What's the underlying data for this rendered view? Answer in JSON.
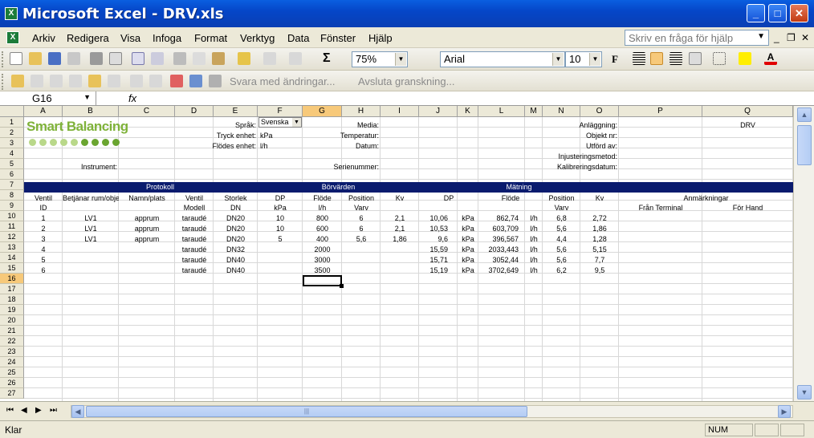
{
  "window": {
    "title": "Microsoft Excel - DRV.xls",
    "app_icon": "excel-icon"
  },
  "menu": [
    "Arkiv",
    "Redigera",
    "Visa",
    "Infoga",
    "Format",
    "Verktyg",
    "Data",
    "Fönster",
    "Hjälp"
  ],
  "help_box": {
    "placeholder": "Skriv en fråga för hjälp"
  },
  "toolbar": {
    "zoom": "75%",
    "font": "Arial",
    "size": "10",
    "bold": "F",
    "sigma": "Σ",
    "review_reply": "Svara med ändringar...",
    "review_end": "Avsluta granskning..."
  },
  "formula_bar": {
    "name_box": "G16",
    "fx": "fx",
    "value": ""
  },
  "columns": [
    "A",
    "B",
    "C",
    "D",
    "E",
    "F",
    "G",
    "H",
    "I",
    "J",
    "K",
    "L",
    "M",
    "N",
    "O",
    "P",
    "Q"
  ],
  "selected_column": "G",
  "rows": [
    "1",
    "2",
    "3",
    "4",
    "5",
    "6",
    "7",
    "8",
    "9",
    "10",
    "11",
    "12",
    "13",
    "14",
    "15",
    "16",
    "17",
    "18",
    "19",
    "20",
    "21",
    "22",
    "23",
    "24",
    "25",
    "26",
    "27"
  ],
  "selected_row": "16",
  "logo": {
    "text": "Smart Balancing"
  },
  "header": {
    "sprak_label": "Språk:",
    "sprak_value": "Svenska",
    "tryck_label": "Tryck enhet:",
    "tryck_value": "kPa",
    "flodes_label": "Flödes enhet:",
    "flodes_value": "l/h",
    "instrument_label": "Instrument:",
    "media_label": "Media:",
    "temperatur_label": "Temperatur:",
    "datum_label": "Datum:",
    "serienummer_label": "Serienummer:",
    "anlaggning_label": "Anläggning:",
    "anlaggning_value": "DRV",
    "objekt_label": "Objekt nr:",
    "utford_label": "Utförd av:",
    "injustering_label": "Injusteringsmetod:",
    "kalibrering_label": "Kalibreringsdatum:"
  },
  "band": {
    "protokoll": "Protokoll",
    "borvarden": "Börvärden",
    "matning": "Mätning"
  },
  "table_headers": {
    "ventil_id_1": "Ventil",
    "ventil_id_2": "ID",
    "betjanar": "Betjänar rum/objekt",
    "namn": "Namn/plats",
    "ventil_modell_1": "Ventil",
    "ventil_modell_2": "Modell",
    "storlek_1": "Storlek",
    "storlek_2": "DN",
    "dp_1": "DP",
    "dp_2": "kPa",
    "flode_1": "Flöde",
    "flode_2": "l/h",
    "position_1": "Position",
    "position_2": "Varv",
    "kv": "Kv",
    "m_dp": "DP",
    "m_flode": "Flöde",
    "m_position_1": "Position",
    "m_position_2": "Varv",
    "m_kv": "Kv",
    "anmarkningar": "Anmärkningar",
    "fran_terminal": "Från Terminal",
    "for_hand": "För Hand"
  },
  "data_rows": [
    {
      "id": "1",
      "betjanar": "LV1",
      "namn": "apprum",
      "modell": "taraudé",
      "dn": "DN20",
      "dp": "10",
      "flode": "800",
      "position": "6",
      "kv": "2,1",
      "m_dp": "10,06",
      "m_dp_unit": "kPa",
      "m_flode": "862,74",
      "m_flode_unit": "l/h",
      "m_position": "6,8",
      "m_kv": "2,72"
    },
    {
      "id": "2",
      "betjanar": "LV1",
      "namn": "apprum",
      "modell": "taraudé",
      "dn": "DN20",
      "dp": "10",
      "flode": "600",
      "position": "6",
      "kv": "2,1",
      "m_dp": "10,53",
      "m_dp_unit": "kPa",
      "m_flode": "603,709",
      "m_flode_unit": "l/h",
      "m_position": "5,6",
      "m_kv": "1,86"
    },
    {
      "id": "3",
      "betjanar": "LV1",
      "namn": "apprum",
      "modell": "taraudé",
      "dn": "DN20",
      "dp": "5",
      "flode": "400",
      "position": "5,6",
      "kv": "1,86",
      "m_dp": "9,6",
      "m_dp_unit": "kPa",
      "m_flode": "396,567",
      "m_flode_unit": "l/h",
      "m_position": "4,4",
      "m_kv": "1,28"
    },
    {
      "id": "4",
      "betjanar": "",
      "namn": "",
      "modell": "taraudé",
      "dn": "DN32",
      "dp": "",
      "flode": "2000",
      "position": "",
      "kv": "",
      "m_dp": "15,59",
      "m_dp_unit": "kPa",
      "m_flode": "2033,443",
      "m_flode_unit": "l/h",
      "m_position": "5,6",
      "m_kv": "5,15"
    },
    {
      "id": "5",
      "betjanar": "",
      "namn": "",
      "modell": "taraudé",
      "dn": "DN40",
      "dp": "",
      "flode": "3000",
      "position": "",
      "kv": "",
      "m_dp": "15,71",
      "m_dp_unit": "kPa",
      "m_flode": "3052,44",
      "m_flode_unit": "l/h",
      "m_position": "5,6",
      "m_kv": "7,7"
    },
    {
      "id": "6",
      "betjanar": "",
      "namn": "",
      "modell": "taraudé",
      "dn": "DN40",
      "dp": "",
      "flode": "3500",
      "position": "",
      "kv": "",
      "m_dp": "15,19",
      "m_dp_unit": "kPa",
      "m_flode": "3702,649",
      "m_flode_unit": "l/h",
      "m_position": "6,2",
      "m_kv": "9,5"
    }
  ],
  "sheet_nav": [
    "⏮",
    "◀",
    "▶",
    "⏭"
  ],
  "status": {
    "text": "Klar",
    "num": "NUM"
  }
}
